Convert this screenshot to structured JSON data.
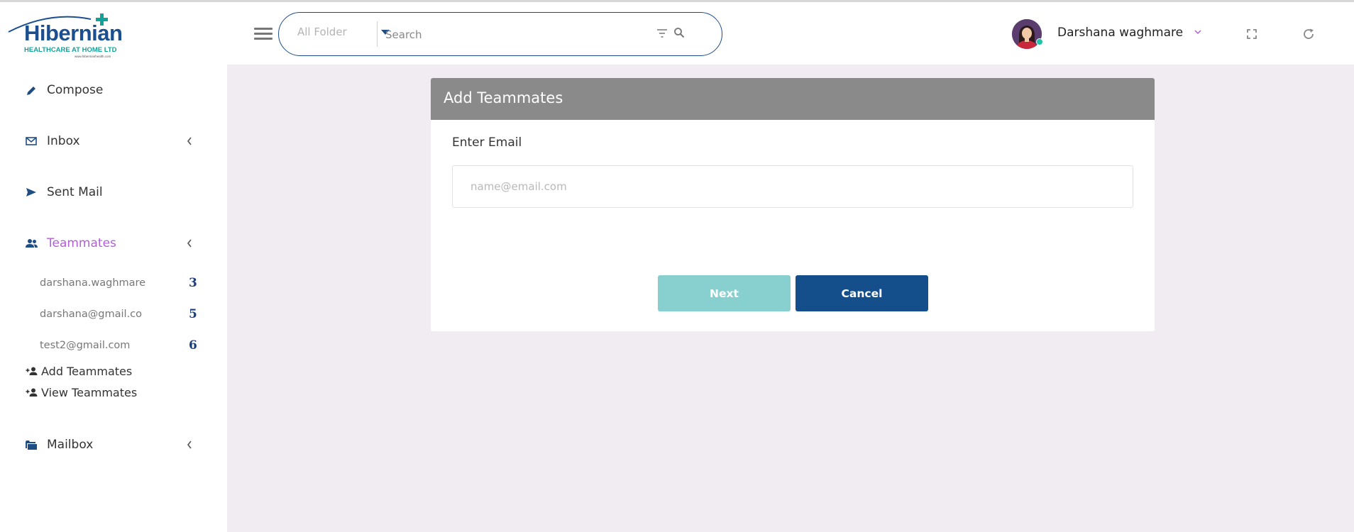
{
  "brand": {
    "name": "Hibernian",
    "tagline": "HEALTHCARE AT HOME LTD",
    "url": "www.hibernianhealth.com"
  },
  "search": {
    "folder_label": "All Folder",
    "placeholder": "Search"
  },
  "user": {
    "name": "Darshana waghmare",
    "status": "online"
  },
  "sidebar": {
    "items": [
      {
        "label": "Compose",
        "icon": "pencil-icon"
      },
      {
        "label": "Inbox",
        "icon": "envelope-icon"
      },
      {
        "label": "Sent Mail",
        "icon": "send-icon"
      },
      {
        "label": "Teammates",
        "icon": "people-icon"
      },
      {
        "label": "Mailbox",
        "icon": "folder-icon"
      }
    ],
    "teammates": [
      {
        "label": "darshana.waghmare",
        "count": "3"
      },
      {
        "label": "darshana@gmail.co",
        "count": "5"
      },
      {
        "label": "test2@gmail.com",
        "count": "6"
      }
    ],
    "actions": [
      {
        "label": "Add Teammates",
        "icon": "add-person-icon"
      },
      {
        "label": "View Teammates",
        "icon": "view-people-icon"
      }
    ]
  },
  "dialog": {
    "title": "Add Teammates",
    "email_label": "Enter Email",
    "email_placeholder": "name@email.com",
    "next_label": "Next",
    "cancel_label": "Cancel"
  },
  "colors": {
    "primary": "#144f8c",
    "accent": "#b15fd8",
    "next_button": "#88cfcf",
    "header_gray": "#8a8a8a",
    "background": "#f1ecf2"
  }
}
